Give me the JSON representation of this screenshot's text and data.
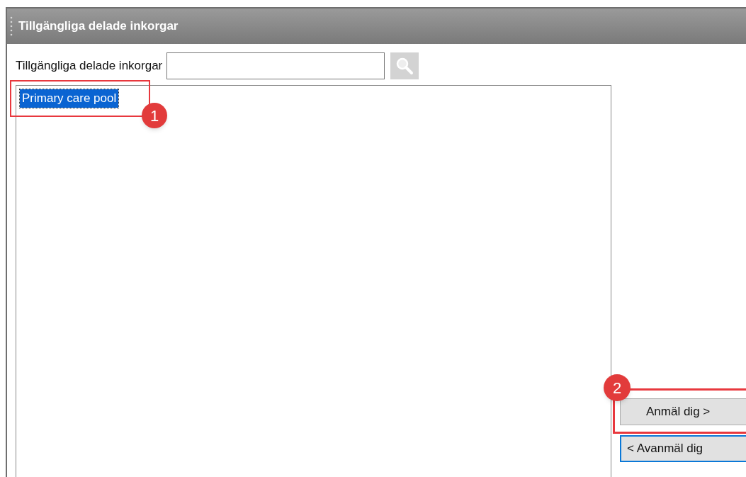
{
  "panel": {
    "title": "Tillgängliga delade inkorgar"
  },
  "search": {
    "label": "Tillgängliga delade inkorgar"
  },
  "list": {
    "items": [
      {
        "label": "Primary care pool",
        "selected": true
      }
    ]
  },
  "buttons": [
    {
      "label": "Anmäl dig >",
      "focused": false
    },
    {
      "label": "< Avanmäl dig",
      "focused": true
    }
  ],
  "callouts": [
    {
      "number": "1"
    },
    {
      "number": "2"
    }
  ]
}
